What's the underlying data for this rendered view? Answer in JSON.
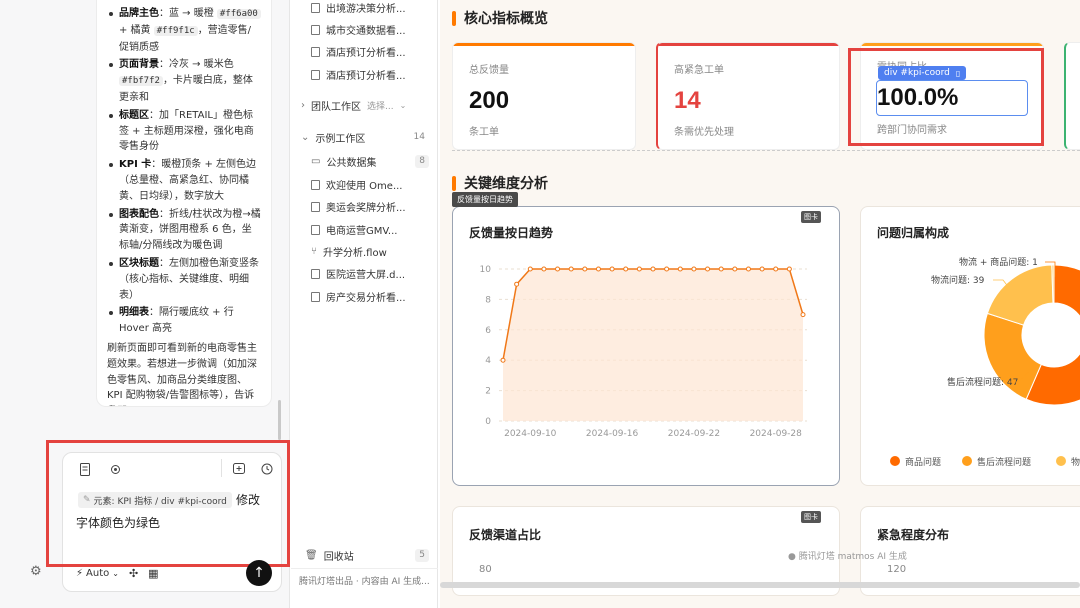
{
  "chat": {
    "bullets": [
      {
        "title": "品牌主色",
        "text_pre": "：蓝 → 暖橙 ",
        "code1": "#ff6a00",
        "mid": " + 橘黄 ",
        "code2": "#ff9f1c",
        "text_post": "，营造零售/促销质感"
      },
      {
        "title": "页面背景",
        "text_pre": "：冷灰 → 暖米色 ",
        "code1": "#fbf7f2",
        "text_post": "，卡片暖白底，整体更亲和"
      },
      {
        "title": "标题区",
        "text": "：加「RETAIL」橙色标签 + 主标题用深橙，强化电商零售身份"
      },
      {
        "title": "KPI 卡",
        "text": "：暖橙顶条 + 左侧色边（总量橙、高紧急红、协同橘黄、日均绿），数字放大"
      },
      {
        "title": "图表配色",
        "text": "：折线/柱状改为橙→橘黄渐变，饼图用橙系 6 色，坐标轴/分隔线改为暖色调"
      },
      {
        "title": "区块标题",
        "text": "：左侧加橙色渐变竖条（核心指标、关键维度、明细表）"
      },
      {
        "title": "明细表",
        "text": "：隔行暖底纹 + 行 Hover 高亮"
      }
    ],
    "summary": "刷新页面即可看到新的电商零售主题效果。若想进一步微调（如加深色零售风、加商品分类维度图、KPI 配购物袋/告警图标等），告诉我即可。",
    "chip": "元素: KPI 指标 / div #kpi-coord",
    "input_text_1": "修改",
    "input_text_2": "字体颜色为绿色",
    "mode": "Auto"
  },
  "tree": {
    "items_top": [
      "出境游决策分析...",
      "城市交通数据看...",
      "酒店预订分析看...",
      "酒店预订分析看..."
    ],
    "team": {
      "label": "团队工作区",
      "select": "选择..."
    },
    "example": {
      "label": "示例工作区",
      "count": "14"
    },
    "items": [
      {
        "label": "公共数据集",
        "badge": "8"
      },
      {
        "label": "欢迎使用 Ome..."
      },
      {
        "label": "奥运会奖牌分析..."
      },
      {
        "label": "电商运营GMV..."
      },
      {
        "label": "升学分析.flow"
      },
      {
        "label": "医院运营大屏.d..."
      },
      {
        "label": "房产交易分析看..."
      }
    ],
    "recycle": {
      "label": "回收站",
      "count": "5"
    },
    "footer": "腾讯灯塔出品 · 内容由 AI 生成..."
  },
  "dash": {
    "sec1": "核心指标概览",
    "sec2": "关键维度分析",
    "kpis": [
      {
        "label": "总反馈量",
        "value": "200",
        "sub": "条工单",
        "color": "#ff7a00",
        "valcolor": "#111"
      },
      {
        "label": "高紧急工单",
        "value": "14",
        "sub": "条需优先处理",
        "color": "#e4433f",
        "valcolor": "#e4433f"
      }
    ],
    "kpi_sel": {
      "label": "需协同占比",
      "value": "100.0%",
      "sub": "跨部门协同需求",
      "tag": "div #kpi-coord"
    },
    "chart1": {
      "tag": "反馈量按日趋势",
      "title": "反馈量按日趋势",
      "badge": "图卡"
    },
    "chart2": {
      "title": "问题归属构成",
      "badge": "图卡"
    },
    "chart3": {
      "title": "反馈渠道占比",
      "badge": "图卡",
      "ytick": "80"
    },
    "chart4": {
      "title": "紧急程度分布",
      "ytick": "120"
    },
    "watermark": "腾讯灯塔 matmos AI 生成"
  },
  "chart_data": [
    {
      "type": "line",
      "title": "反馈量按日趋势",
      "x": [
        "2024-09-08",
        "2024-09-09",
        "2024-09-10",
        "2024-09-11",
        "2024-09-12",
        "2024-09-13",
        "2024-09-14",
        "2024-09-15",
        "2024-09-16",
        "2024-09-17",
        "2024-09-18",
        "2024-09-19",
        "2024-09-20",
        "2024-09-21",
        "2024-09-22",
        "2024-09-23",
        "2024-09-24",
        "2024-09-25",
        "2024-09-26",
        "2024-09-27",
        "2024-09-28",
        "2024-09-29",
        "2024-09-30"
      ],
      "values": [
        4,
        9,
        10,
        10,
        10,
        10,
        10,
        10,
        10,
        10,
        10,
        10,
        10,
        10,
        10,
        10,
        10,
        10,
        10,
        10,
        10,
        10,
        7
      ],
      "xticks": [
        "2024-09-10",
        "2024-09-16",
        "2024-09-22",
        "2024-09-28"
      ],
      "yticks": [
        "0",
        "2",
        "4",
        "6",
        "8",
        "10"
      ],
      "ylim": [
        0,
        10
      ],
      "color": "#f07818"
    },
    {
      "type": "pie",
      "title": "问题归属构成",
      "labels": [
        "商品问题",
        "售后流程问题",
        "物流问题",
        "物流 + 商品问题"
      ],
      "values": [
        113,
        47,
        39,
        1
      ],
      "colors": [
        "#ff6a00",
        "#ff9f1c",
        "#ffc04d",
        "#ffd27a"
      ],
      "annotations": [
        "物流 + 商品问题: 1",
        "物流问题: 39",
        "售后流程问题: 47"
      ],
      "legend": [
        "商品问题",
        "售后流程问题",
        "物"
      ]
    }
  ]
}
